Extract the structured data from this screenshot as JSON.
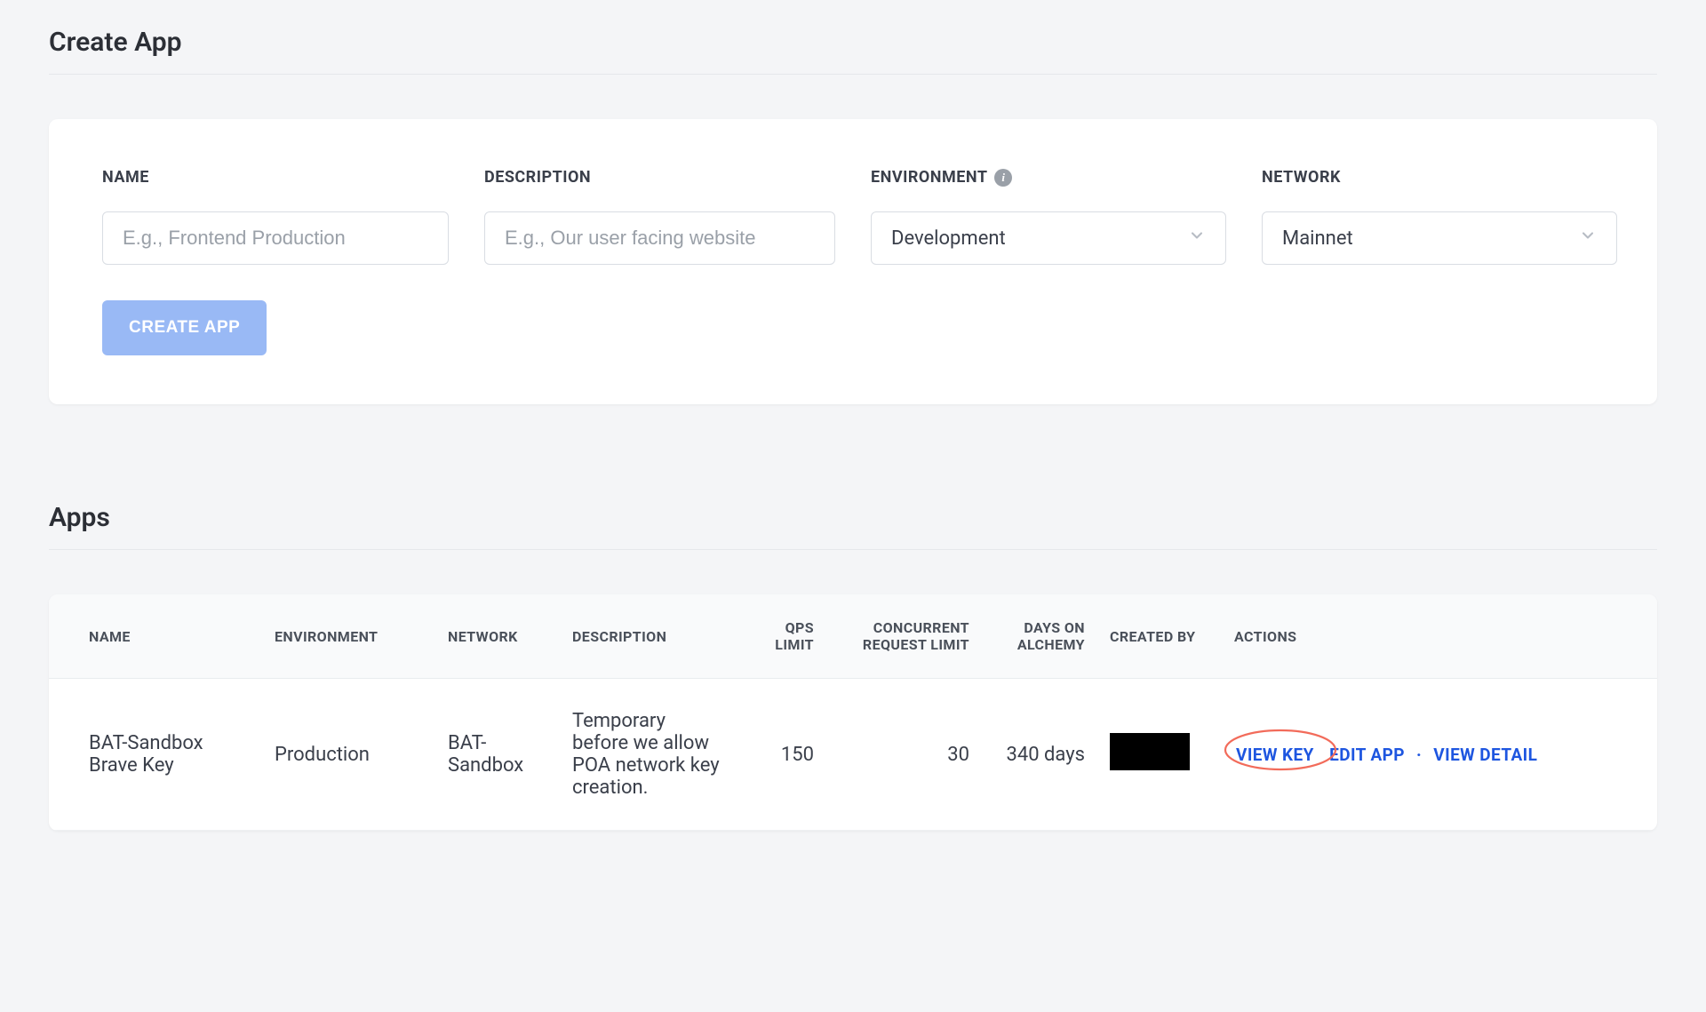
{
  "create": {
    "title": "Create App",
    "fields": {
      "name": {
        "label": "NAME",
        "placeholder": "E.g., Frontend Production"
      },
      "description": {
        "label": "DESCRIPTION",
        "placeholder": "E.g., Our user facing website"
      },
      "environment": {
        "label": "ENVIRONMENT",
        "value": "Development"
      },
      "network": {
        "label": "NETWORK",
        "value": "Mainnet"
      }
    },
    "button": "CREATE APP"
  },
  "apps": {
    "title": "Apps",
    "headers": {
      "name": "NAME",
      "environment": "ENVIRONMENT",
      "network": "NETWORK",
      "description": "DESCRIPTION",
      "qps": "QPS LIMIT",
      "concurrent": "CONCURRENT REQUEST LIMIT",
      "days": "DAYS ON ALCHEMY",
      "created_by": "CREATED BY",
      "actions": "ACTIONS"
    },
    "rows": [
      {
        "name": "BAT-Sandbox Brave Key",
        "environment": "Production",
        "network": "BAT-Sandbox",
        "description": "Temporary before we allow POA network key creation.",
        "qps": "150",
        "concurrent": "30",
        "days": "340 days",
        "created_by": ""
      }
    ],
    "actions": {
      "view_key": "VIEW KEY",
      "edit_app": "EDIT APP",
      "view_detail": "VIEW DETAIL"
    }
  }
}
